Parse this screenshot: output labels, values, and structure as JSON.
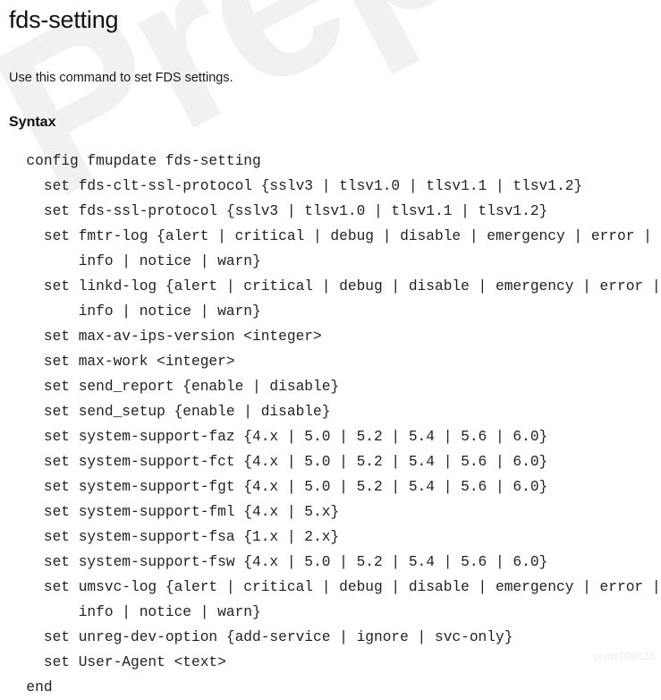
{
  "document": {
    "title": "fds-setting",
    "intro": "Use this command to set FDS settings.",
    "syntax_heading": "Syntax"
  },
  "watermarks": {
    "primary": "PrepAway",
    "primary_color": "#f1f1f1",
    "footer_code": "praw709528",
    "footer_color": "#ececec"
  },
  "syntax": {
    "lines": [
      "  config fmupdate fds-setting",
      "    set fds-clt-ssl-protocol {sslv3 | tlsv1.0 | tlsv1.1 | tlsv1.2}",
      "    set fds-ssl-protocol {sslv3 | tlsv1.0 | tlsv1.1 | tlsv1.2}",
      "    set fmtr-log {alert | critical | debug | disable | emergency | error |",
      "        info | notice | warn}",
      "    set linkd-log {alert | critical | debug | disable | emergency | error |",
      "        info | notice | warn}",
      "    set max-av-ips-version <integer>",
      "    set max-work <integer>",
      "    set send_report {enable | disable}",
      "    set send_setup {enable | disable}",
      "    set system-support-faz {4.x | 5.0 | 5.2 | 5.4 | 5.6 | 6.0}",
      "    set system-support-fct {4.x | 5.0 | 5.2 | 5.4 | 5.6 | 6.0}",
      "    set system-support-fgt {4.x | 5.0 | 5.2 | 5.4 | 5.6 | 6.0}",
      "    set system-support-fml {4.x | 5.x}",
      "    set system-support-fsa {1.x | 2.x}",
      "    set system-support-fsw {4.x | 5.0 | 5.2 | 5.4 | 5.6 | 6.0}",
      "    set umsvc-log {alert | critical | debug | disable | emergency | error |",
      "        info | notice | warn}",
      "    set unreg-dev-option {add-service | ignore | svc-only}",
      "    set User-Agent <text>",
      "  end"
    ]
  }
}
